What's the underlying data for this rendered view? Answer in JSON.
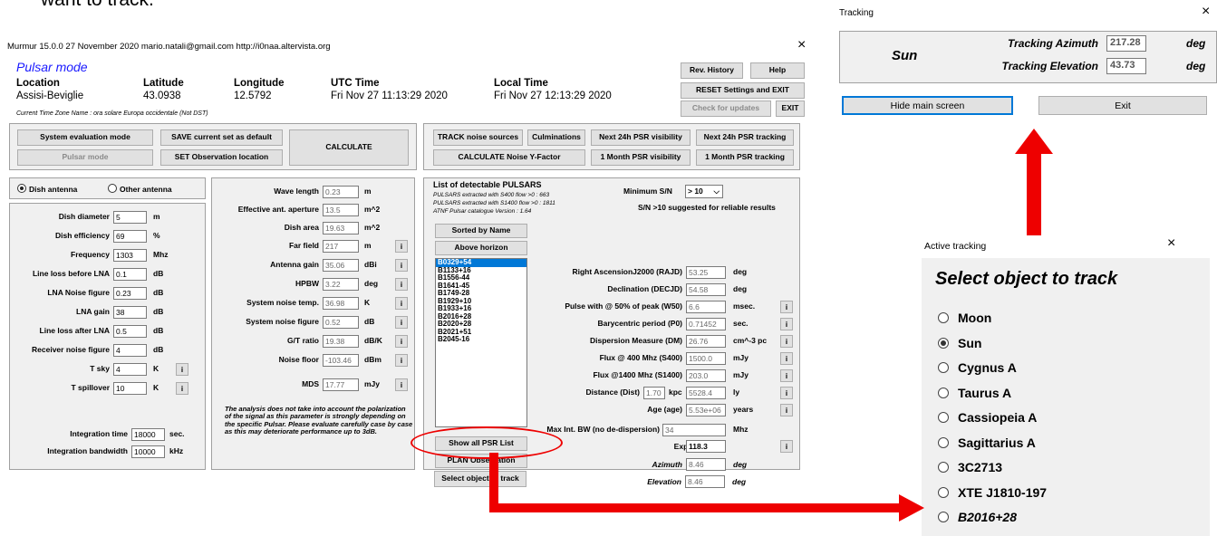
{
  "top_text": "want to track.",
  "main": {
    "title": "Murmur 15.0.0   27 November 2020   mario.natali@gmail.com   http://i0naa.altervista.org",
    "close": "×",
    "mode_title": "Pulsar mode",
    "location_label": "Location",
    "location_value": "Assisi-Beviglie",
    "latitude_label": "Latitude",
    "latitude_value": "43.0938",
    "longitude_label": "Longitude",
    "longitude_value": "12.5792",
    "utc_label": "UTC Time",
    "utc_value": "Fri Nov 27 11:13:29 2020",
    "local_label": "Local Time",
    "local_value": "Fri Nov 27 12:13:29 2020",
    "timezone": "Current Time Zone Name : ora solare Europa occidentale (Not DST)",
    "buttons": {
      "rev_history": "Rev. History",
      "help": "Help",
      "reset": "RESET Settings and EXIT",
      "check_updates": "Check for updates",
      "exit": "EXIT",
      "system_eval": "System evaluation mode",
      "save_default": "SAVE current set  as default",
      "calculate": "CALCULATE",
      "pulsar_mode": "Pulsar mode",
      "set_location": "SET Observation location",
      "track_noise": "TRACK noise sources",
      "culminations": "Culminations",
      "next24_vis": "Next 24h PSR visibility",
      "next24_track": "Next 24h PSR tracking",
      "calc_noise": "CALCULATE Noise Y-Factor",
      "month_vis": "1 Month PSR visibility",
      "month_track": "1 Month PSR tracking",
      "sorted_name": "Sorted by Name",
      "above_horizon": "Above horizon",
      "show_all": "Show all PSR List",
      "plan_obs": "PLAN Observation",
      "select_track": "Select object  to track"
    },
    "antenna": {
      "dish": "Dish antenna",
      "other": "Other antenna",
      "fields": [
        {
          "label": "Dish diameter",
          "value": "5",
          "unit": "m"
        },
        {
          "label": "Dish efficiency",
          "value": "69",
          "unit": "%"
        },
        {
          "label": "Frequency",
          "value": "1303",
          "unit": "Mhz"
        },
        {
          "label": "Line loss before LNA",
          "value": "0.1",
          "unit": "dB"
        },
        {
          "label": "LNA Noise figure",
          "value": "0.23",
          "unit": "dB"
        },
        {
          "label": "LNA gain",
          "value": "38",
          "unit": "dB"
        },
        {
          "label": "Line loss after LNA",
          "value": "0.5",
          "unit": "dB"
        },
        {
          "label": "Receiver noise figure",
          "value": "4",
          "unit": "dB"
        },
        {
          "label": "T sky",
          "value": "4",
          "unit": "K"
        },
        {
          "label": "T spillover",
          "value": "10",
          "unit": "K"
        }
      ],
      "integration_time_label": "Integration time",
      "integration_time_value": "18000",
      "integration_time_unit": "sec.",
      "integration_bw_label": "Integration bandwidth",
      "integration_bw_value": "10000",
      "integration_bw_unit": "kHz"
    },
    "results": {
      "fields": [
        {
          "label": "Wave length",
          "value": "0.23",
          "unit": "m"
        },
        {
          "label": "Effective ant. aperture",
          "value": "13.5",
          "unit": "m^2"
        },
        {
          "label": "Dish area",
          "value": "19.63",
          "unit": "m^2"
        },
        {
          "label": "Far field",
          "value": "217",
          "unit": "m"
        },
        {
          "label": "Antenna gain",
          "value": "35.06",
          "unit": "dBi"
        },
        {
          "label": "HPBW",
          "value": "3.22",
          "unit": "deg"
        },
        {
          "label": "System noise temp.",
          "value": "36.98",
          "unit": "K"
        },
        {
          "label": "System noise figure",
          "value": "0.52",
          "unit": "dB"
        },
        {
          "label": "G/T ratio",
          "value": "19.38",
          "unit": "dB/K"
        },
        {
          "label": "Noise floor",
          "value": "-103.46",
          "unit": "dBm"
        },
        {
          "label": "MDS",
          "value": "17.77",
          "unit": "mJy"
        }
      ],
      "note": "The analysis does not take into account the polarization of the signal as this parameter is strongly depending on the specific Pulsar. Please evaluate carefully case by case as this may deteriorate performance up to 3dB."
    },
    "pulsars": {
      "title": "List of  detectable PULSARS",
      "info1": "PULSARS extracted with  S400 flow >0 :  663",
      "info2": "PULSARS extracted with S1400 flow >0 :  1811",
      "info3": "ATNF Pulsar catalogue Version          :  1.64",
      "min_sn_label": "Minimum S/N",
      "min_sn_value": "> 10",
      "sn_hint": "S/N >10 suggested for reliable results",
      "list": [
        "B0329+54",
        "B1133+16",
        "B1556-44",
        "B1641-45",
        "B1749-28",
        "B1929+10",
        "B1933+16",
        "B2016+28",
        "B2020+28",
        "B2021+51",
        "B2045-16"
      ],
      "fields": [
        {
          "label": "Right AscensionJ2000 (RAJD)",
          "value": "53.25",
          "unit": "deg",
          "info": false
        },
        {
          "label": "Declination (DECJD)",
          "value": "54.58",
          "unit": "deg",
          "info": false
        },
        {
          "label": "Pulse with @ 50% of peak (W50)",
          "value": "6.6",
          "unit": "msec.",
          "info": true
        },
        {
          "label": "Barycentric period (P0)",
          "value": "0.71452",
          "unit": "sec.",
          "info": true
        },
        {
          "label": "Dispersion Measure (DM)",
          "value": "26.76",
          "unit": "cm^-3 pc",
          "info": true
        },
        {
          "label": "Flux @ 400 Mhz (S400)",
          "value": "1500.0",
          "unit": "mJy",
          "info": true
        },
        {
          "label": "Flux @1400 Mhz (S1400)",
          "value": "203.0",
          "unit": "mJy",
          "info": true
        }
      ],
      "distance_label": "Distance (Dist)",
      "distance_kpc": "1.70",
      "distance_kpc_unit": "kpc",
      "distance_ly": "5528.4",
      "distance_ly_unit": "ly",
      "age_label": "Age (age)",
      "age_value": "5.53e+06",
      "age_unit": "years",
      "maxbw_label": "Max Int. BW (no de-dispersion)",
      "maxbw_value": "34",
      "maxbw_unit": "Mhz",
      "expected_label": "Expected S/N",
      "expected_value": "118.3",
      "azimuth_label": "Azimuth",
      "azimuth_value": "8.46",
      "azimuth_unit": "deg",
      "elevation_label": "Elevation",
      "elevation_value": "8.46",
      "elevation_unit": "deg"
    }
  },
  "tracking": {
    "title": "Tracking",
    "close": "×",
    "object": "Sun",
    "az_label": "Tracking Azimuth",
    "az_value": "217.28",
    "az_unit": "deg",
    "el_label": "Tracking Elevation",
    "el_value": "43.73",
    "el_unit": "deg",
    "hide": "Hide main screen",
    "exit": "Exit"
  },
  "active": {
    "title": "Active tracking",
    "close": "×",
    "heading": "Select object to track",
    "options": [
      "Moon",
      "Sun",
      "Cygnus A",
      "Taurus A",
      "Cassiopeia A",
      "Sagittarius A",
      "3C2713",
      "XTE J1810-197",
      "B2016+28"
    ],
    "selected": "Sun"
  },
  "colors": {
    "arrow": "#ee0000",
    "title_blue": "#1a1aff",
    "focus": "#0078d7"
  }
}
